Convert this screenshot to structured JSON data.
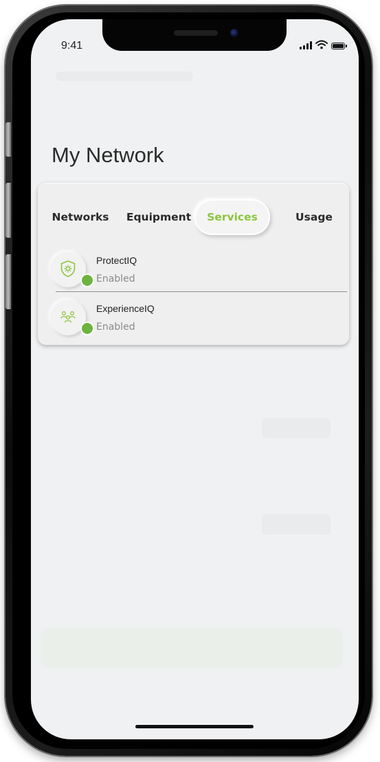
{
  "status_bar": {
    "time": "9:41"
  },
  "page": {
    "title": "My Network"
  },
  "tabs": [
    {
      "label": "Networks",
      "selected": false
    },
    {
      "label": "Equipment",
      "selected": false
    },
    {
      "label": "Services",
      "selected": true
    },
    {
      "label": "Usage",
      "selected": false
    }
  ],
  "services": [
    {
      "name": "ProtectIQ",
      "status": "Enabled",
      "icon": "shield-icon"
    },
    {
      "name": "ExperienceIQ",
      "status": "Enabled",
      "icon": "people-icon"
    }
  ],
  "colors": {
    "accent_green": "#8cc63f",
    "status_green": "#6cb33f",
    "background": "#f0f1f2"
  }
}
